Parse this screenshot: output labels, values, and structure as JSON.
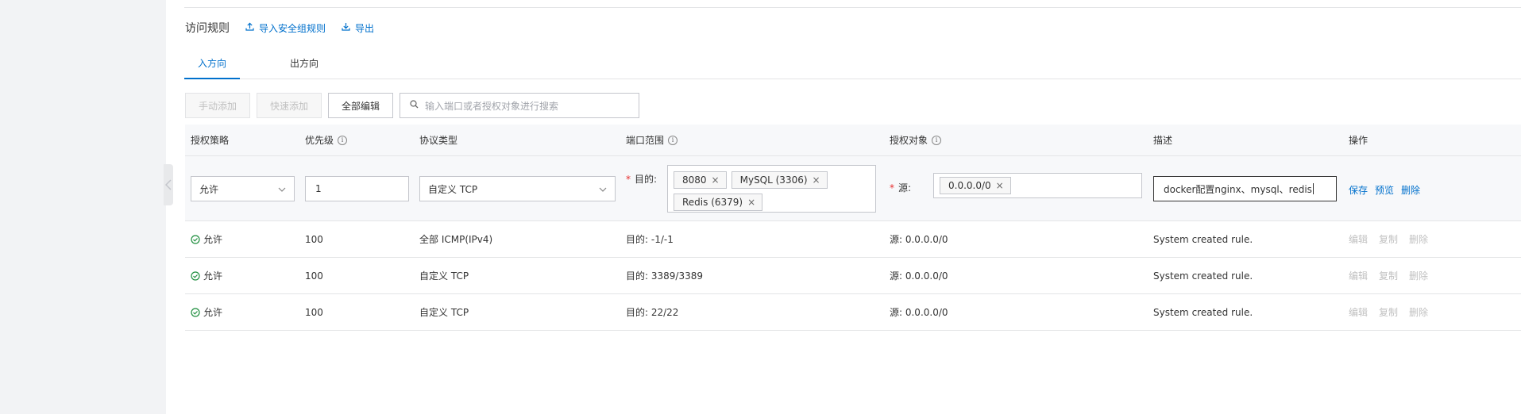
{
  "section": {
    "title": "访问规则",
    "import_label": "导入安全组规则",
    "export_label": "导出"
  },
  "tabs": [
    {
      "label": "入方向",
      "active": true
    },
    {
      "label": "出方向",
      "active": false
    }
  ],
  "toolbar": {
    "manual_add": "手动添加",
    "quick_add": "快速添加",
    "edit_all": "全部编辑",
    "search_placeholder": "输入端口或者授权对象进行搜索"
  },
  "columns": {
    "policy": "授权策略",
    "priority": "优先级",
    "protocol": "协议类型",
    "port_range": "端口范围",
    "auth_object": "授权对象",
    "description": "描述",
    "actions": "操作"
  },
  "edit_row": {
    "policy": "允许",
    "priority": "1",
    "protocol": "自定义 TCP",
    "dest_label": "目的:",
    "port_tags": [
      "8080",
      "MySQL (3306)",
      "Redis (6379)"
    ],
    "source_label": "源:",
    "source_tags": [
      "0.0.0.0/0"
    ],
    "description": "docker配置nginx、mysql、redis",
    "save": "保存",
    "preview": "预览",
    "delete": "删除"
  },
  "rows": [
    {
      "policy": "允许",
      "priority": "100",
      "protocol": "全部 ICMP(IPv4)",
      "port": "目的: -1/-1",
      "source": "源: 0.0.0.0/0",
      "description": "System created rule.",
      "edit": "编辑",
      "copy": "复制",
      "delete": "删除"
    },
    {
      "policy": "允许",
      "priority": "100",
      "protocol": "自定义 TCP",
      "port": "目的: 3389/3389",
      "source": "源: 0.0.0.0/0",
      "description": "System created rule.",
      "edit": "编辑",
      "copy": "复制",
      "delete": "删除"
    },
    {
      "policy": "允许",
      "priority": "100",
      "protocol": "自定义 TCP",
      "port": "目的: 22/22",
      "source": "源: 0.0.0.0/0",
      "description": "System created rule.",
      "edit": "编辑",
      "copy": "复制",
      "delete": "删除"
    }
  ],
  "colors": {
    "accent": "#0070cc",
    "success": "#1e8e3e",
    "required": "#e62e2e",
    "disabled_text": "#c1c1c1"
  },
  "icons": [
    "upload-icon",
    "download-icon",
    "search-icon",
    "info-icon",
    "chevron-down-icon",
    "close-icon",
    "check-circle-icon",
    "chevron-left-icon"
  ]
}
